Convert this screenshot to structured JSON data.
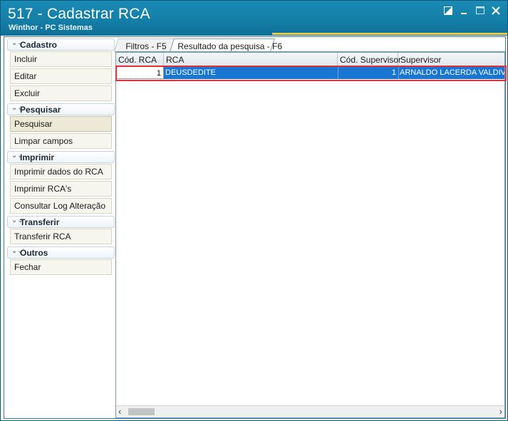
{
  "window": {
    "title": "517 - Cadastrar RCA",
    "subtitle": "Winthor - PC Sistemas",
    "accent_color": "#e9c84a",
    "controls": [
      "restore-icon",
      "minimize-icon",
      "maximize-icon",
      "close-icon"
    ]
  },
  "sidebar": {
    "groups": [
      {
        "label": "Cadastro",
        "items": [
          "Incluir",
          "Editar",
          "Excluir"
        ]
      },
      {
        "label": "Pesquisar",
        "items": [
          "Pesquisar",
          "Limpar campos"
        ]
      },
      {
        "label": "Imprimir",
        "items": [
          "Imprimir dados do RCA",
          "Imprimir RCA's",
          "Consultar Log Alteração"
        ]
      },
      {
        "label": "Transferir",
        "items": [
          "Transferir RCA"
        ]
      },
      {
        "label": "Outros",
        "items": [
          "Fechar"
        ]
      }
    ],
    "active_item": "Pesquisar"
  },
  "tabs": [
    {
      "label": "Filtros - F5"
    },
    {
      "label": "Resultado da pesquisa - F6",
      "selected": true
    }
  ],
  "grid": {
    "columns": [
      "Cód. RCA",
      "RCA",
      "Cód. Supervisor",
      "Supervisor"
    ],
    "rows": [
      [
        "1",
        "DEUSDEDITE",
        "1",
        "ARNALDO LACERDA VALDIVINO"
      ]
    ],
    "selected_row_color": "#1976d2",
    "highlight_color": "#e0313c"
  }
}
